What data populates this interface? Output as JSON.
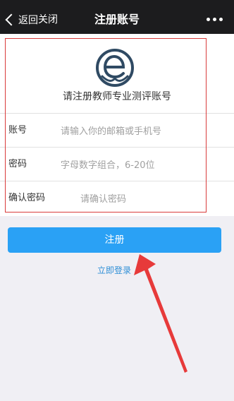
{
  "nav": {
    "back_label": "返回",
    "close_label": "关闭",
    "title": "注册账号"
  },
  "form": {
    "subtitle": "请注册教师专业测评账号",
    "account": {
      "label": "账号",
      "placeholder": "请输入你的邮箱或手机号"
    },
    "password": {
      "label": "密码",
      "placeholder": "字母数字组合，6-20位"
    },
    "confirm": {
      "label": "确认密码",
      "placeholder": "请确认密码"
    }
  },
  "actions": {
    "register_label": "注册",
    "login_link": "立即登录"
  },
  "colors": {
    "nav_bg": "#1c1c1e",
    "primary": "#2aa1f5",
    "link": "#2f8fd6",
    "annotation_red": "#d93b3b"
  },
  "icons": {
    "back": "chevron-left-icon",
    "more": "more-dots-icon",
    "logo": "e-logo-icon",
    "annotation": "red-arrow-annotation"
  }
}
